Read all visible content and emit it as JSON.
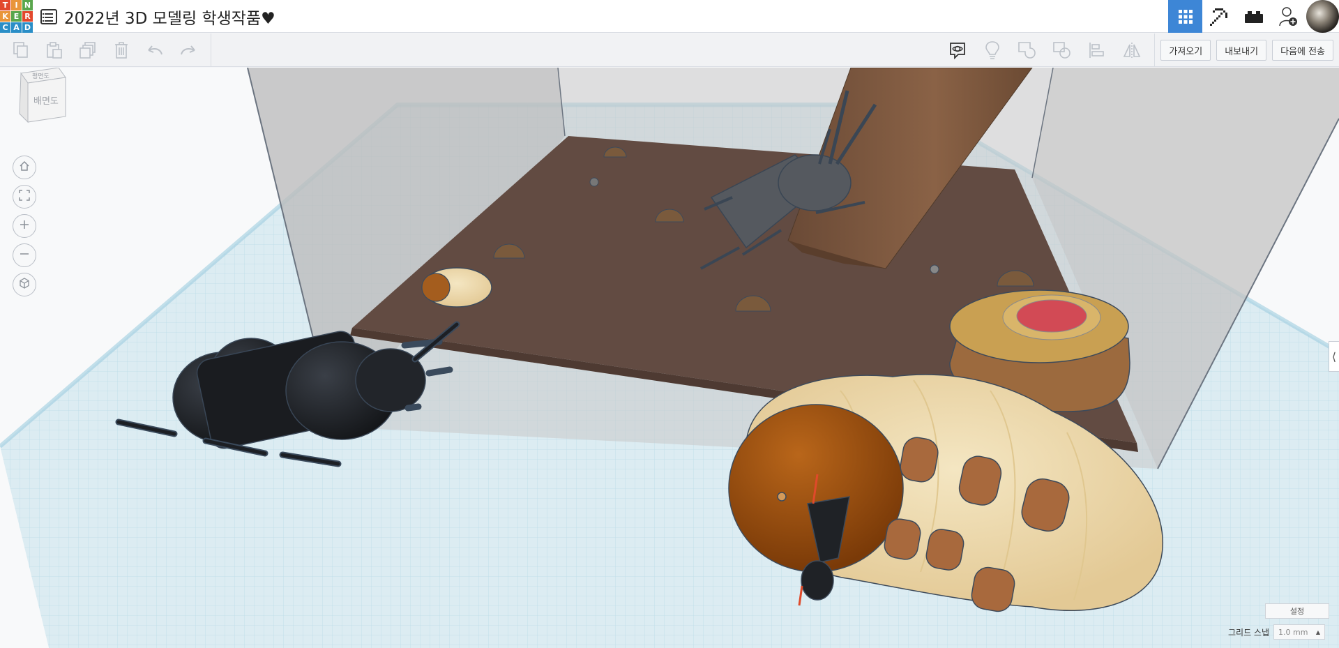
{
  "app": {
    "logo_letters": [
      "T",
      "I",
      "N",
      "K",
      "E",
      "R",
      "C",
      "A",
      "D"
    ],
    "logo_colors": [
      "#e2482d",
      "#e9953a",
      "#5aa64d",
      "#e9953a",
      "#5aa64d",
      "#e2482d",
      "#2a8ec7",
      "#2a8ec7",
      "#2a8ec7"
    ],
    "design_title": "2022년 3D 모델링 학생작품♥"
  },
  "header": {
    "icons": [
      "3d-design-grid-icon",
      "codeblocks-pickaxe-icon",
      "lego-brick-icon",
      "add-user-icon"
    ],
    "accent": "#3d86d6"
  },
  "toolbar": {
    "left_icons": [
      "copy-icon",
      "paste-icon",
      "duplicate-icon",
      "delete-icon",
      "undo-icon",
      "redo-icon"
    ],
    "right_icons": [
      "notes-icon",
      "light-bulb-icon",
      "group-icon",
      "ungroup-icon",
      "align-icon",
      "mirror-icon"
    ],
    "import_label": "가져오기",
    "export_label": "내보내기",
    "send_to_label": "다음에 전송"
  },
  "viewcube": {
    "top_face": "평면도",
    "front_face": "배면도"
  },
  "view_controls": [
    "home-icon",
    "fit-all-icon",
    "zoom-in-icon",
    "zoom-out-icon",
    "orthographic-icon"
  ],
  "workplane": {
    "settings_label": "설정",
    "snap_label": "그리드 스냅",
    "snap_value": "1.0 mm"
  }
}
